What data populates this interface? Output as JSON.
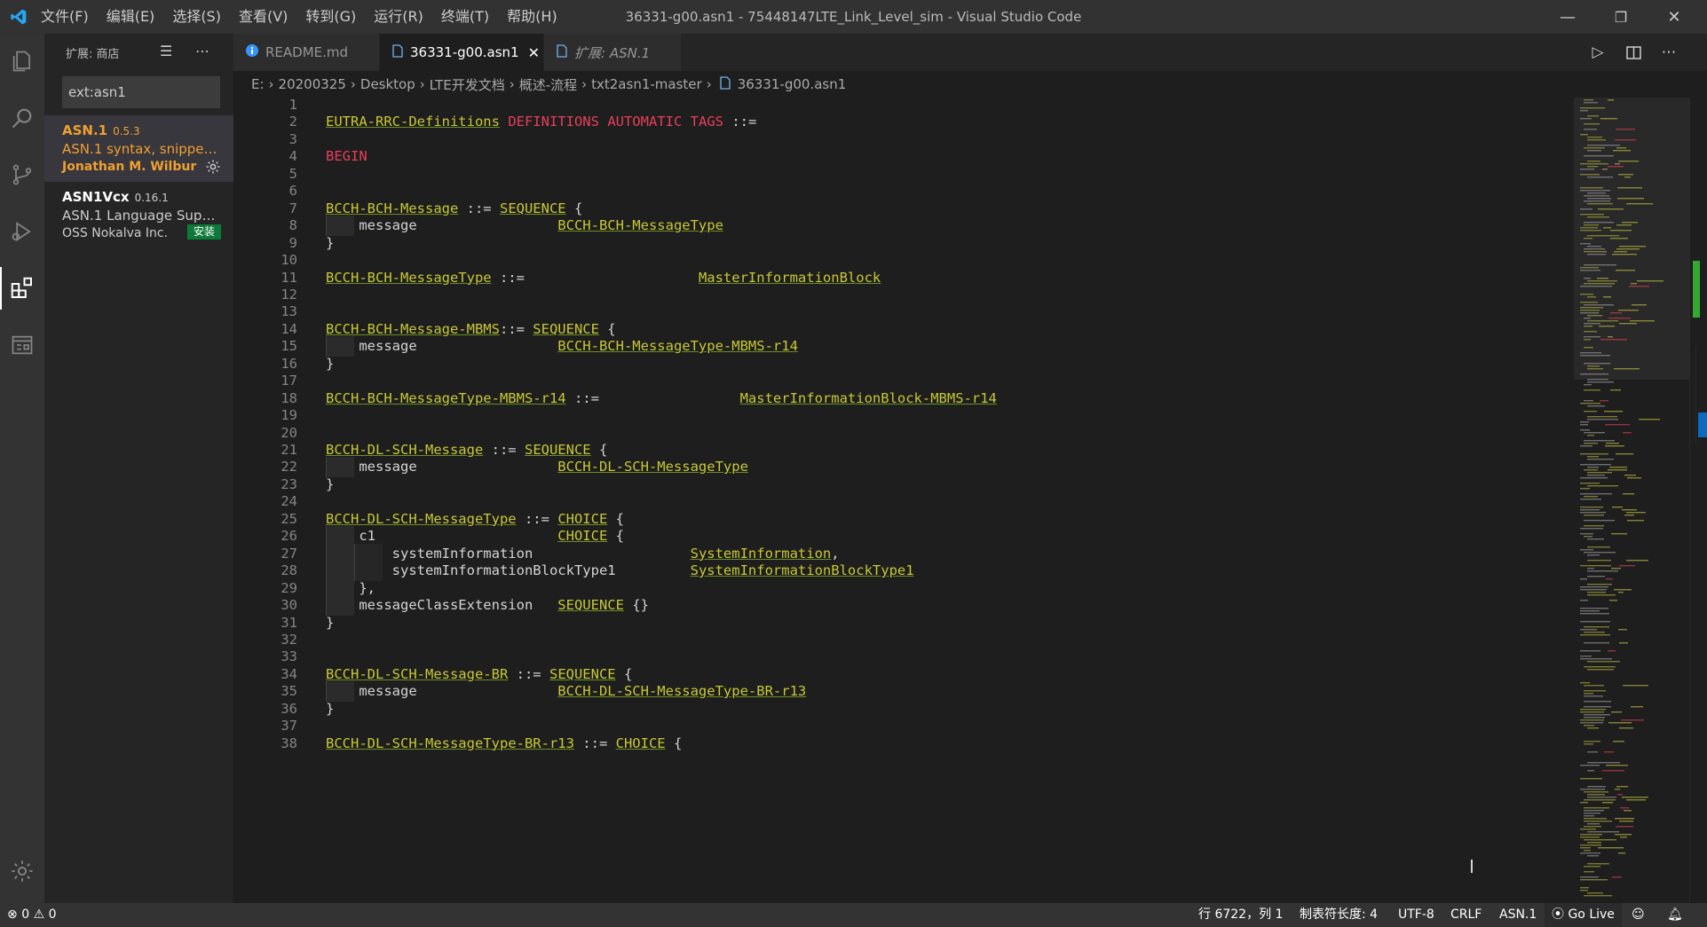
{
  "window": {
    "title": "36331-g00.asn1 - 75448147LTE_Link_Level_sim - Visual Studio Code",
    "menu": [
      "文件(F)",
      "编辑(E)",
      "选择(S)",
      "查看(V)",
      "转到(G)",
      "运行(R)",
      "终端(T)",
      "帮助(H)"
    ],
    "controls": {
      "minimize": "—",
      "restore": "❐",
      "close": "✕"
    }
  },
  "activity_bar": {
    "items": [
      "explorer",
      "search",
      "source-control",
      "run-debug",
      "extensions",
      "remote-explorer"
    ],
    "active": "extensions",
    "bottom": "manage"
  },
  "sidebar": {
    "title": "扩展: 商店",
    "search_value": "ext:asn1",
    "extensions": [
      {
        "name": "ASN.1",
        "version": "0.5.3",
        "description": "ASN.1 syntax, snippets,...",
        "publisher": "Jonathan M. Wilbur",
        "selected": true
      },
      {
        "name": "ASN1Vcx",
        "version": "0.16.1",
        "description": "ASN.1 Language Supp...",
        "publisher": "OSS Nokalva Inc.",
        "action": "安装",
        "selected": false
      }
    ]
  },
  "tabs": [
    {
      "label": "README.md",
      "icon": "info-icon",
      "active": false,
      "italic": false
    },
    {
      "label": "36331-g00.asn1",
      "icon": "file-icon",
      "active": true,
      "italic": false,
      "close": "✕"
    },
    {
      "label": "扩展: ASN.1",
      "icon": "file-icon",
      "active": false,
      "italic": true
    }
  ],
  "breadcrumb": [
    "E:",
    "20200325",
    "Desktop",
    "LTE开发文档",
    "概述-流程",
    "txt2asn1-master",
    "36331-g00.asn1"
  ],
  "editor": {
    "lines": [
      {
        "n": "1",
        "tokens": []
      },
      {
        "n": "2",
        "tokens": [
          [
            "ident",
            "EUTRA-RRC-Definitions"
          ],
          [
            "plain",
            " "
          ],
          [
            "kw",
            "DEFINITIONS"
          ],
          [
            "plain",
            " "
          ],
          [
            "kw",
            "AUTOMATIC"
          ],
          [
            "plain",
            " "
          ],
          [
            "kw",
            "TAGS"
          ],
          [
            "plain",
            " ::="
          ]
        ]
      },
      {
        "n": "3",
        "tokens": []
      },
      {
        "n": "4",
        "tokens": [
          [
            "kw",
            "BEGIN"
          ]
        ]
      },
      {
        "n": "5",
        "tokens": []
      },
      {
        "n": "6",
        "tokens": []
      },
      {
        "n": "7",
        "tokens": [
          [
            "ident",
            "BCCH-BCH-Message"
          ],
          [
            "plain",
            " ::= "
          ],
          [
            "ident",
            "SEQUENCE"
          ],
          [
            "plain",
            " {"
          ]
        ]
      },
      {
        "n": "8",
        "indent": 1,
        "tokens": [
          [
            "plain",
            "    message                 "
          ],
          [
            "ident",
            "BCCH-BCH-MessageType"
          ]
        ]
      },
      {
        "n": "9",
        "tokens": [
          [
            "plain",
            "}"
          ]
        ]
      },
      {
        "n": "10",
        "tokens": []
      },
      {
        "n": "11",
        "tokens": [
          [
            "ident",
            "BCCH-BCH-MessageType"
          ],
          [
            "plain",
            " ::=                     "
          ],
          [
            "ident",
            "MasterInformationBlock"
          ]
        ]
      },
      {
        "n": "12",
        "tokens": []
      },
      {
        "n": "13",
        "tokens": []
      },
      {
        "n": "14",
        "tokens": [
          [
            "ident",
            "BCCH-BCH-Message-MBMS"
          ],
          [
            "plain",
            "::= "
          ],
          [
            "ident",
            "SEQUENCE"
          ],
          [
            "plain",
            " {"
          ]
        ]
      },
      {
        "n": "15",
        "indent": 1,
        "tokens": [
          [
            "plain",
            "    message                 "
          ],
          [
            "ident",
            "BCCH-BCH-MessageType-MBMS-r14"
          ]
        ]
      },
      {
        "n": "16",
        "tokens": [
          [
            "plain",
            "}"
          ]
        ]
      },
      {
        "n": "17",
        "tokens": []
      },
      {
        "n": "18",
        "tokens": [
          [
            "ident",
            "BCCH-BCH-MessageType-MBMS-r14"
          ],
          [
            "plain",
            " ::=                 "
          ],
          [
            "ident",
            "MasterInformationBlock-MBMS-r14"
          ]
        ]
      },
      {
        "n": "19",
        "tokens": []
      },
      {
        "n": "20",
        "tokens": []
      },
      {
        "n": "21",
        "tokens": [
          [
            "ident",
            "BCCH-DL-SCH-Message"
          ],
          [
            "plain",
            " ::= "
          ],
          [
            "ident",
            "SEQUENCE"
          ],
          [
            "plain",
            " {"
          ]
        ]
      },
      {
        "n": "22",
        "indent": 1,
        "tokens": [
          [
            "plain",
            "    message                 "
          ],
          [
            "ident",
            "BCCH-DL-SCH-MessageType"
          ]
        ]
      },
      {
        "n": "23",
        "tokens": [
          [
            "plain",
            "}"
          ]
        ]
      },
      {
        "n": "24",
        "tokens": []
      },
      {
        "n": "25",
        "tokens": [
          [
            "ident",
            "BCCH-DL-SCH-MessageType"
          ],
          [
            "plain",
            " ::= "
          ],
          [
            "ident",
            "CHOICE"
          ],
          [
            "plain",
            " {"
          ]
        ]
      },
      {
        "n": "26",
        "indent": 1,
        "tokens": [
          [
            "plain",
            "    c1                      "
          ],
          [
            "ident",
            "CHOICE"
          ],
          [
            "plain",
            " {"
          ]
        ]
      },
      {
        "n": "27",
        "indent": 2,
        "tokens": [
          [
            "plain",
            "        systemInformation                   "
          ],
          [
            "ident",
            "SystemInformation"
          ],
          [
            "plain",
            ","
          ]
        ]
      },
      {
        "n": "28",
        "indent": 2,
        "tokens": [
          [
            "plain",
            "        systemInformationBlockType1         "
          ],
          [
            "ident",
            "SystemInformationBlockType1"
          ]
        ]
      },
      {
        "n": "29",
        "indent": 1,
        "tokens": [
          [
            "plain",
            "    },"
          ]
        ]
      },
      {
        "n": "30",
        "indent": 1,
        "tokens": [
          [
            "plain",
            "    messageClassExtension   "
          ],
          [
            "ident",
            "SEQUENCE"
          ],
          [
            "plain",
            " {}"
          ]
        ]
      },
      {
        "n": "31",
        "tokens": [
          [
            "plain",
            "}"
          ]
        ]
      },
      {
        "n": "32",
        "tokens": []
      },
      {
        "n": "33",
        "tokens": []
      },
      {
        "n": "34",
        "tokens": [
          [
            "ident",
            "BCCH-DL-SCH-Message-BR"
          ],
          [
            "plain",
            " ::= "
          ],
          [
            "ident",
            "SEQUENCE"
          ],
          [
            "plain",
            " {"
          ]
        ]
      },
      {
        "n": "35",
        "indent": 1,
        "tokens": [
          [
            "plain",
            "    message                 "
          ],
          [
            "ident",
            "BCCH-DL-SCH-MessageType-BR-r13"
          ]
        ]
      },
      {
        "n": "36",
        "tokens": [
          [
            "plain",
            "}"
          ]
        ]
      },
      {
        "n": "37",
        "tokens": []
      },
      {
        "n": "38",
        "tokens": [
          [
            "ident",
            "BCCH-DL-SCH-MessageType-BR-r13"
          ],
          [
            "plain",
            " ::= "
          ],
          [
            "ident",
            "CHOICE"
          ],
          [
            "plain",
            " {"
          ]
        ]
      }
    ]
  },
  "status_bar": {
    "errors": "0",
    "warnings": "0",
    "position": "行 6722，列 1",
    "tab_size": "制表符长度: 4",
    "encoding": "UTF-8",
    "eol": "CRLF",
    "language": "ASN.1",
    "go_live": "Go Live"
  },
  "colors": {
    "accent_extension": "#f0a030",
    "identifier": "#c8c836",
    "keyword": "#e83e5a",
    "install_button": "#0e7a3a"
  }
}
